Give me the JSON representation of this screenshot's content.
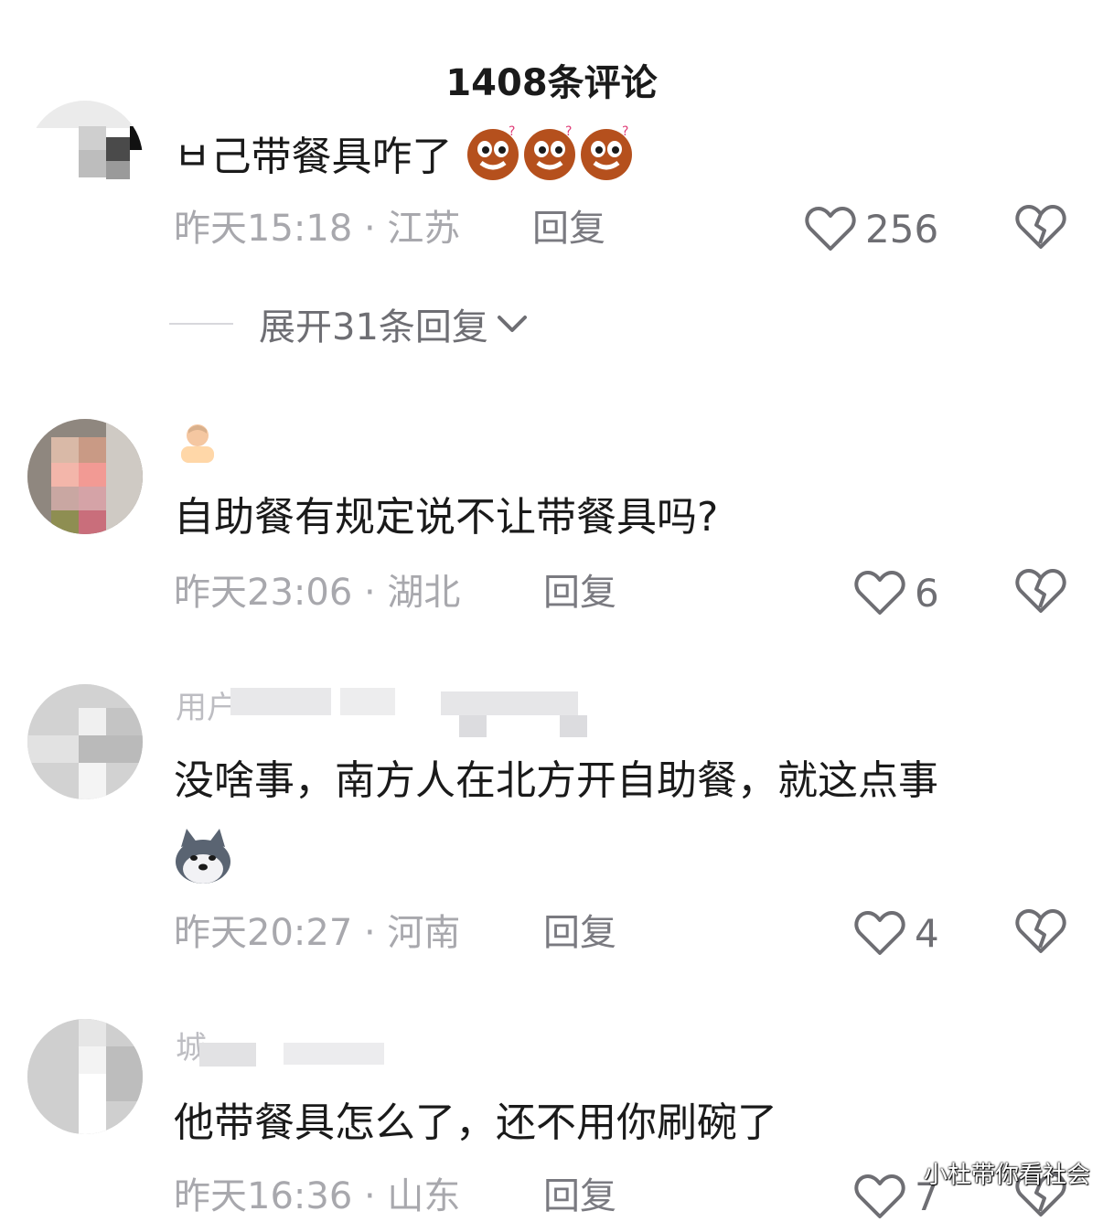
{
  "header": {
    "title": "1408条评论"
  },
  "comments": [
    {
      "username_visible": "",
      "text": "ㅂ己带餐具咋了",
      "emoji": [
        "confused-face-emoji",
        "confused-face-emoji",
        "confused-face-emoji"
      ],
      "time": "昨天15:18 · 江苏",
      "reply_label": "回复",
      "likes": "256",
      "expand_label": "展开31条回复"
    },
    {
      "username_visible": "",
      "text": "自助餐有规定说不让带餐具吗?",
      "time": "昨天23:06 · 湖北",
      "reply_label": "回复",
      "likes": "6"
    },
    {
      "username_visible": "用户",
      "text": "没啥事，南方人在北方开自助餐，就这点事",
      "emoji": [
        "husky-dog-emoji"
      ],
      "time": "昨天20:27 · 河南",
      "reply_label": "回复",
      "likes": "4"
    },
    {
      "username_visible": "城",
      "text": "他带餐具怎么了，还不用你刷碗了",
      "time": "昨天16:36 · 山东",
      "reply_label": "回复",
      "likes": "7"
    }
  ],
  "watermark": "小杜带你看社会",
  "colors": {
    "text": "#1a1a1a",
    "meta": "#a8a8ad",
    "icon": "#6e6e73"
  }
}
